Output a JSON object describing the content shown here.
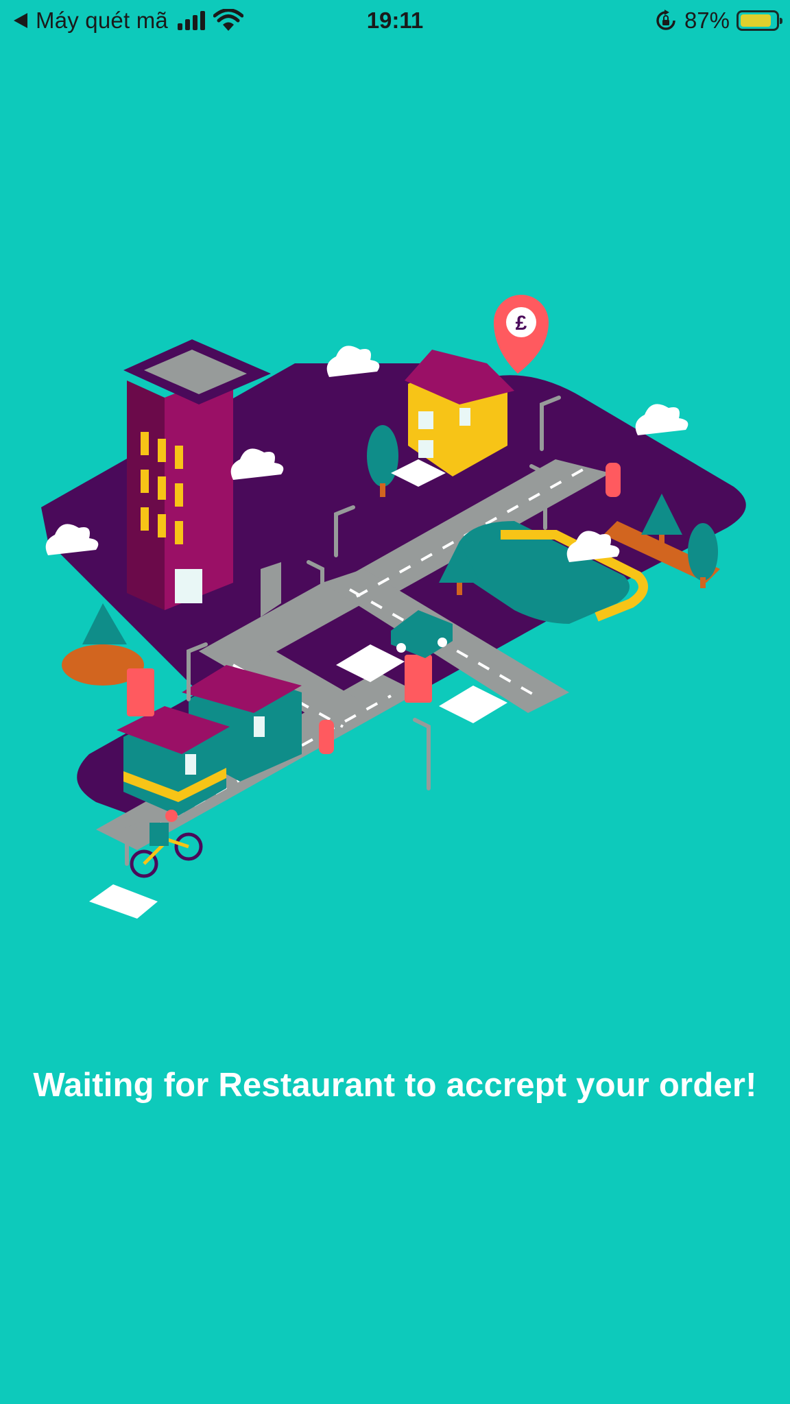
{
  "status_bar": {
    "back_app": "Máy quét mã",
    "time": "19:11",
    "battery_percent": "87%",
    "battery_level": 0.87,
    "battery_color": "#f7d11e"
  },
  "illustration": {
    "pin_symbol": "£"
  },
  "message": "Waiting for Restaurant to accrept your order!",
  "colors": {
    "background": "#0dcabb",
    "ground": "#4a0a5a",
    "road": "#979b9a",
    "building": "#9a1066",
    "accent_red": "#ff5a5f",
    "accent_yellow": "#f7c417"
  }
}
